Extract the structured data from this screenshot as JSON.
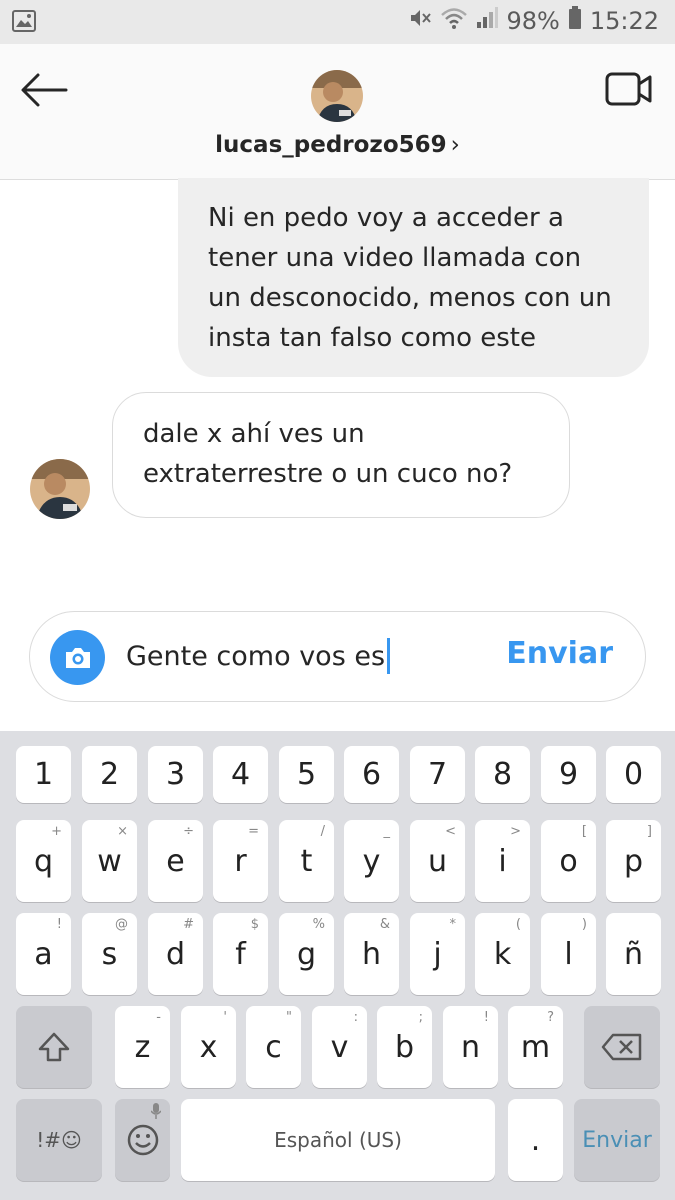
{
  "status_bar": {
    "battery": "98%",
    "time": "15:22",
    "icons": [
      "gallery-icon",
      "mute-icon",
      "wifi-icon",
      "signal-icon",
      "battery-icon"
    ]
  },
  "header": {
    "username": "lucas_pedrozo569",
    "chevron": "›",
    "icons": [
      "back-arrow-icon",
      "video-call-icon"
    ]
  },
  "messages": {
    "outgoing": {
      "lines": [
        "Ni en pedo voy a acceder a",
        "tener una video llamada con",
        "un desconocido, menos con un",
        "insta tan falso como este"
      ]
    },
    "incoming": {
      "lines": [
        "dale x ahí ves un",
        "extraterrestre o un cuco no?"
      ]
    }
  },
  "composer": {
    "value": "Gente como vos es",
    "send_label": "Enviar"
  },
  "keyboard": {
    "numbers": [
      "1",
      "2",
      "3",
      "4",
      "5",
      "6",
      "7",
      "8",
      "9",
      "0"
    ],
    "row1": [
      "q",
      "w",
      "e",
      "r",
      "t",
      "y",
      "u",
      "i",
      "o",
      "p"
    ],
    "row1_hints": [
      "+",
      "×",
      "÷",
      "=",
      "/",
      "_",
      "<",
      ">",
      "[",
      "]"
    ],
    "row2": [
      "a",
      "s",
      "d",
      "f",
      "g",
      "h",
      "j",
      "k",
      "l",
      "ñ"
    ],
    "row2_hints": [
      "!",
      "@",
      "#",
      "$",
      "%",
      "&",
      "*",
      "(",
      ")",
      ""
    ],
    "row3": [
      "z",
      "x",
      "c",
      "v",
      "b",
      "n",
      "m"
    ],
    "row3_hints": [
      "-",
      "'",
      "\"",
      ":",
      ";",
      "!",
      "?"
    ],
    "symbols_label": "!#☺",
    "space_label": "Español (US)",
    "period_label": ".",
    "enter_label": "Enviar"
  },
  "colors": {
    "accent": "#3897f0",
    "bubble_out": "#efefef",
    "keyboard_bg": "#dddee2"
  }
}
